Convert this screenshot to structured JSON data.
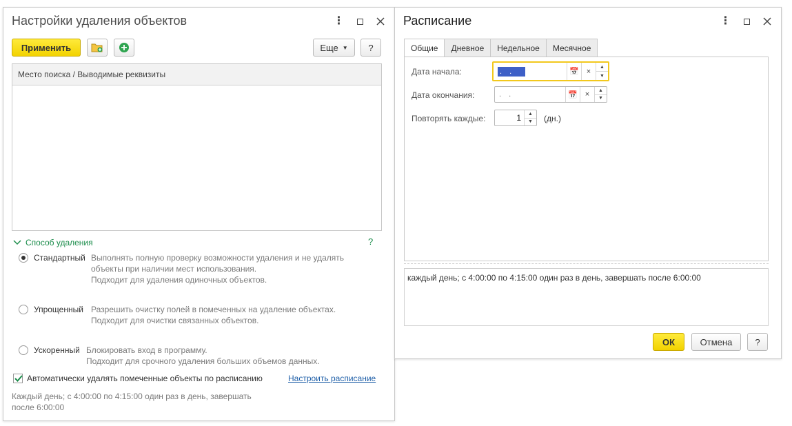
{
  "left_window": {
    "title": "Настройки удаления объектов",
    "toolbar": {
      "apply_label": "Применить",
      "more_label": "Еще",
      "help_label": "?"
    },
    "list": {
      "header": "Место поиска / Выводимые реквизиты"
    },
    "deletion_method": {
      "title": "Способ удаления",
      "help_label": "?",
      "options": [
        {
          "label": "Стандартный",
          "selected": true,
          "desc_line1": "Выполнять полную проверку возможности удаления и не удалять",
          "desc_line2": "объекты при наличии мест использования.",
          "desc_line3": "Подходит для удаления одиночных объектов."
        },
        {
          "label": "Упрощенный",
          "selected": false,
          "desc_line1": "Разрешить очистку полей в помеченных на удаление объектах.",
          "desc_line2": "Подходит для очистки связанных объектов."
        },
        {
          "label": "Ускоренный",
          "selected": false,
          "desc_line1": "Блокировать вход в программу.",
          "desc_line2": "Подходит для срочного удаления больших объемов данных."
        }
      ]
    },
    "auto_delete": {
      "checked": true,
      "label": "Автоматически удалять помеченные объекты по расписанию",
      "link": "Настроить расписание"
    },
    "schedule_summary": {
      "line1": "Каждый день; с 4:00:00 по 4:15:00 один раз в день, завершать",
      "line2": "после 6:00:00"
    }
  },
  "right_window": {
    "title": "Расписание",
    "tabs": [
      {
        "label": "Общие",
        "active": true
      },
      {
        "label": "Дневное",
        "active": false
      },
      {
        "label": "Недельное",
        "active": false
      },
      {
        "label": "Месячное",
        "active": false
      }
    ],
    "fields": {
      "start_label": "Дата начала:",
      "start_value": ". .",
      "end_label": "Дата окончания:",
      "end_value": ". .",
      "repeat_label": "Повторять каждые:",
      "repeat_value": "1",
      "repeat_unit": "(дн.)"
    },
    "summary": "каждый день; с 4:00:00 по 4:15:00 один раз в день, завершать после 6:00:00",
    "buttons": {
      "ok": "ОК",
      "cancel": "Отмена",
      "help": "?"
    }
  },
  "colors": {
    "primary_button": "#f2d200",
    "group_title": "#1a8c4a",
    "link": "#1f5fa8",
    "focus_border": "#f2c81c",
    "selection": "#3d5fc7"
  }
}
